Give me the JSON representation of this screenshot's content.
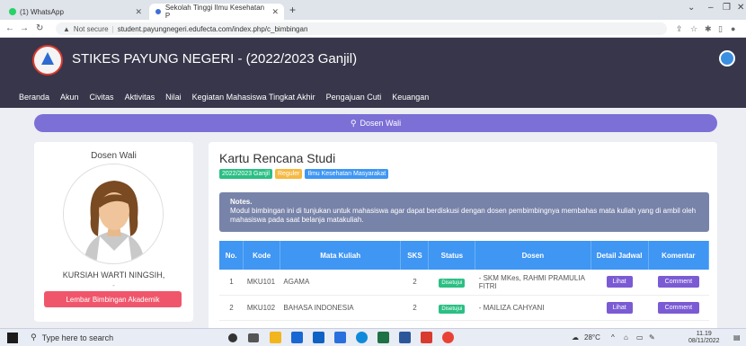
{
  "browser": {
    "tabs": [
      {
        "title": "(1) WhatsApp"
      },
      {
        "title": "Sekolah Tinggi Ilmu Kesehatan P"
      }
    ],
    "address": {
      "not_secure": "Not secure",
      "url": "student.payungnegeri.edufecta.com/index.php/c_bimbingan"
    }
  },
  "site": {
    "title": "STIKES PAYUNG NEGERI - (2022/2023 Ganjil)",
    "menu": [
      "Beranda",
      "Akun",
      "Civitas",
      "Aktivitas",
      "Nilai",
      "Kegiatan Mahasiswa Tingkat Akhir",
      "Pengajuan Cuti",
      "Keuangan"
    ]
  },
  "banner": {
    "label": "Dosen Wali"
  },
  "left_card": {
    "heading": "Dosen Wali",
    "name": "KURSIAH WARTI NINGSIH,",
    "dash": "-",
    "button": "Lembar Bimbingan Akademik"
  },
  "right_card": {
    "title": "Kartu Rencana Studi",
    "badges": [
      {
        "label": "2022/2023 Ganjil",
        "color": "#2bbf84"
      },
      {
        "label": "Reguler",
        "color": "#f5b942"
      },
      {
        "label": "Ilmu Kesehatan Masyarakat",
        "color": "#3f96f3"
      }
    ],
    "notes_title": "Notes.",
    "notes_text": "Modul bimbingan ini di tunjukan untuk mahasiswa agar dapat berdiskusi dengan dosen pembimbingnya membahas mata kuliah yang di ambil oleh mahasiswa pada saat belanja matakuliah.",
    "table": {
      "headers": [
        "No.",
        "Kode",
        "Mata Kuliah",
        "SKS",
        "Status",
        "Dosen",
        "Detail Jadwal",
        "Komentar"
      ],
      "rows": [
        {
          "no": "1",
          "kode": "MKU101",
          "mk": "AGAMA",
          "sks": "2",
          "status": "Disetujui",
          "dosen": "- SKM MKes, RAHMI PRAMULIA FITRI",
          "detail": "Lihat",
          "komentar": "Comment"
        },
        {
          "no": "2",
          "kode": "MKU102",
          "mk": "BAHASA INDONESIA",
          "sks": "2",
          "status": "Disetujui",
          "dosen": "- MAILIZA CAHYANI",
          "detail": "Lihat",
          "komentar": "Comment"
        }
      ]
    }
  },
  "taskbar": {
    "search": "Type here to search",
    "weather": "28°C",
    "time": "11.19",
    "date": "08/11/2022"
  }
}
